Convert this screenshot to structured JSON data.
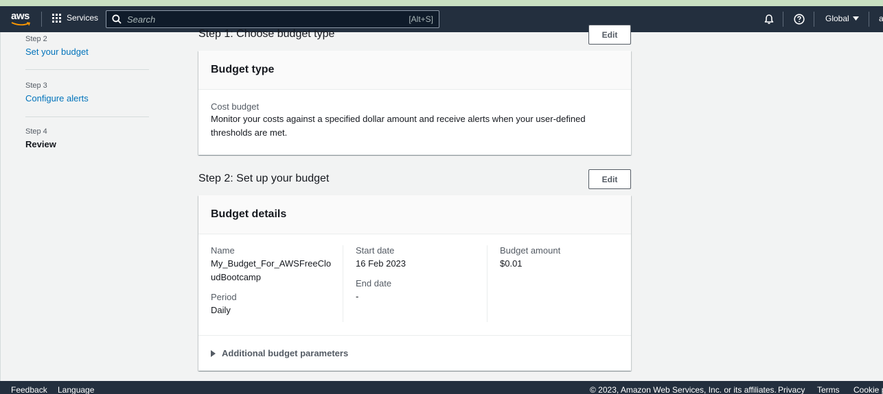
{
  "topbar": {
    "logo": "aws",
    "services_label": "Services",
    "search_placeholder": "Search",
    "search_shortcut": "[Alt+S]",
    "region_label": "Global",
    "account_label": "a"
  },
  "steps": [
    {
      "number": "Step 2",
      "label": "Set your budget"
    },
    {
      "number": "Step 3",
      "label": "Configure alerts"
    },
    {
      "number": "Step 4",
      "label": "Review"
    }
  ],
  "step1": {
    "title": "Step 1: Choose budget type",
    "edit_label": "Edit",
    "card_title": "Budget type",
    "type_label": "Cost budget",
    "type_description": "Monitor your costs against a specified dollar amount and receive alerts when your user-defined thresholds are met."
  },
  "step2": {
    "title": "Step 2: Set up your budget",
    "edit_label": "Edit",
    "card_title": "Budget details",
    "name_label": "Name",
    "name_value": "My_Budget_For_AWSFreeCloudBootcamp",
    "period_label": "Period",
    "period_value": "Daily",
    "start_label": "Start date",
    "start_value": "16 Feb 2023",
    "end_label": "End date",
    "end_value": "-",
    "amount_label": "Budget amount",
    "amount_value": "$0.01",
    "additional_label": "Additional budget parameters"
  },
  "footer": {
    "feedback": "Feedback",
    "language": "Language",
    "copyright": "© 2023, Amazon Web Services, Inc. or its affiliates.",
    "privacy": "Privacy",
    "terms": "Terms",
    "cookie": "Cookie p"
  }
}
